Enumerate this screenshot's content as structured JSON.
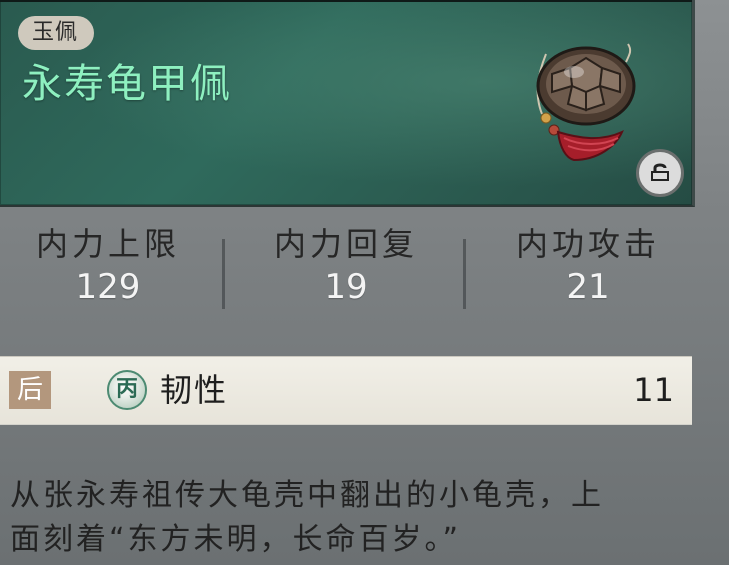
{
  "item": {
    "category": "玉佩",
    "name": "永寿龟甲佩"
  },
  "stats": [
    {
      "label": "内力上限",
      "value": "129"
    },
    {
      "label": "内力回复",
      "value": "19"
    },
    {
      "label": "内功攻击",
      "value": "21"
    }
  ],
  "attribute": {
    "slot": "后",
    "grade": "丙",
    "name": "韧性",
    "value": "11"
  },
  "description": {
    "line1": "从张永寿祖传大龟壳中翻出的小龟壳，上",
    "line2": "面刻着“东方未明，长命百岁。”"
  },
  "colors": {
    "header_bg": "#2f6a5c",
    "title_color": "#8ef0c0",
    "slot_tag": "#b3977d",
    "attr_bar": "#f1efe7"
  },
  "icons": {
    "pendant": "turtle-shell-pendant-icon",
    "lock": "lock-icon",
    "grade": "grade-badge-icon"
  }
}
